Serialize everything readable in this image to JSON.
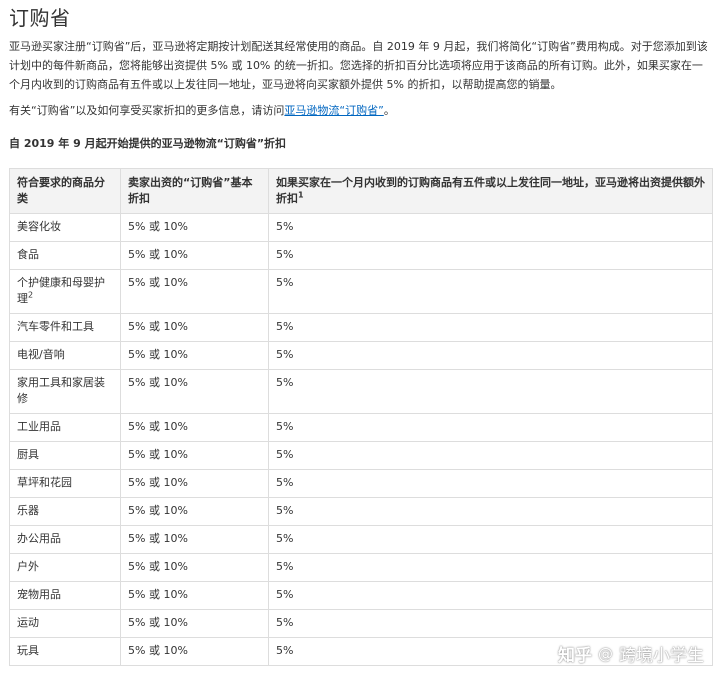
{
  "page": {
    "title": "订购省",
    "intro": "亚马逊买家注册“订购省”后，亚马逊将定期按计划配送其经常使用的商品。自 2019 年 9 月起，我们将简化“订购省”费用构成。对于您添加到该计划中的每件新商品，您将能够出资提供 5% 或 10% 的统一折扣。您选择的折扣百分比选项将应用于该商品的所有订购。此外，如果买家在一个月内收到的订购商品有五件或以上发往同一地址，亚马逊将向买家额外提供 5% 的折扣，以帮助提高您的销量。",
    "more_info_prefix": "有关“订购省”以及如何享受买家折扣的更多信息，请访问",
    "more_info_link": "亚马逊物流“订购省”",
    "more_info_suffix": "。",
    "section_heading": "自 2019 年 9 月起开始提供的亚马逊物流“订购省”折扣"
  },
  "table": {
    "headers": {
      "category": "符合要求的商品分类",
      "base_discount": "卖家出资的“订购省”基本折扣",
      "extra_discount": "如果买家在一个月内收到的订购商品有五件或以上发往同一地址，亚马逊将出资提供额外折扣",
      "extra_discount_sup": "1"
    },
    "rows": [
      {
        "category": "美容化妆",
        "sup": "",
        "base": "5% 或 10%",
        "extra": "5%"
      },
      {
        "category": "食品",
        "sup": "",
        "base": "5% 或 10%",
        "extra": "5%"
      },
      {
        "category": "个护健康和母婴护理",
        "sup": "2",
        "base": "5% 或 10%",
        "extra": "5%"
      },
      {
        "category": "汽车零件和工具",
        "sup": "",
        "base": "5% 或 10%",
        "extra": "5%"
      },
      {
        "category": "电视/音响",
        "sup": "",
        "base": "5% 或 10%",
        "extra": "5%"
      },
      {
        "category": "家用工具和家居装修",
        "sup": "",
        "base": "5% 或 10%",
        "extra": "5%"
      },
      {
        "category": "工业用品",
        "sup": "",
        "base": "5% 或 10%",
        "extra": "5%"
      },
      {
        "category": "厨具",
        "sup": "",
        "base": "5% 或 10%",
        "extra": "5%"
      },
      {
        "category": "草坪和花园",
        "sup": "",
        "base": "5% 或 10%",
        "extra": "5%"
      },
      {
        "category": "乐器",
        "sup": "",
        "base": "5% 或 10%",
        "extra": "5%"
      },
      {
        "category": "办公用品",
        "sup": "",
        "base": "5% 或 10%",
        "extra": "5%"
      },
      {
        "category": "户外",
        "sup": "",
        "base": "5% 或 10%",
        "extra": "5%"
      },
      {
        "category": "宠物用品",
        "sup": "",
        "base": "5% 或 10%",
        "extra": "5%"
      },
      {
        "category": "运动",
        "sup": "",
        "base": "5% 或 10%",
        "extra": "5%"
      },
      {
        "category": "玩具",
        "sup": "",
        "base": "5% 或 10%",
        "extra": "5%"
      }
    ]
  },
  "watermark": {
    "logo": "知乎",
    "at": "@",
    "author": "跨境小学生"
  }
}
